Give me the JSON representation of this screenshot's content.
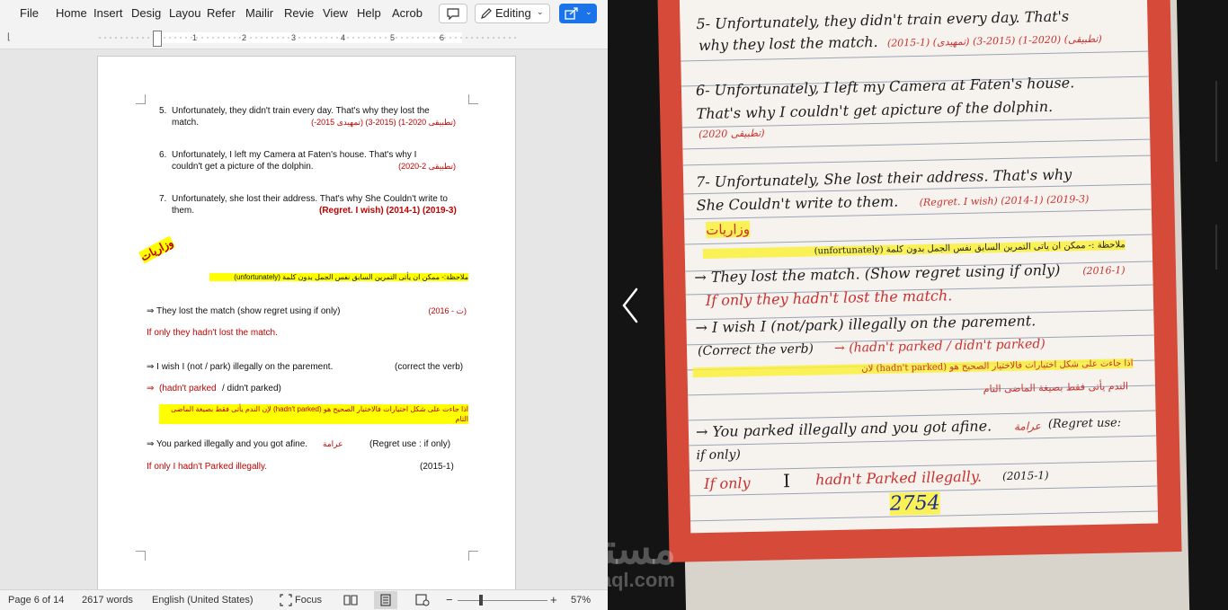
{
  "ribbon": {
    "tabs": [
      "File",
      "Home",
      "Insert",
      "Desig",
      "Layou",
      "Refer",
      "Mailir",
      "Revie",
      "View",
      "Help",
      "Acrob"
    ],
    "editing_label": "Editing"
  },
  "ruler": {
    "numbers": [
      "1",
      "2",
      "3",
      "4",
      "5",
      "6"
    ]
  },
  "document": {
    "item5": {
      "num": "5.",
      "line1": "Unfortunately, they didn't train every day. That's why they lost the",
      "line2": "match.",
      "ref": "(تطبيقى 2020-1) (2015-3) (تمهيدى 2015-)"
    },
    "item6": {
      "num": "6.",
      "line1": "Unfortunately, I left my Camera at Faten's house. That's why I",
      "line2": "couldn't get a picture of the dolphin.",
      "ref": "(تطبيقى 2-2020)"
    },
    "item7": {
      "num": "7.",
      "line1": "Unfortunately, she lost their address. That's why She Couldn't write to",
      "line2": "them.",
      "ref": "(Regret. I wish) (2014-1) (2019-3)"
    },
    "heading": "وزاريات",
    "note": "ملاحظة:- ممكن ان يأتى التمرين السابق نفس الجمل  بدون كلمة (unfortunately)",
    "q1": {
      "text": "⇒ They lost the match   (show regret using if only)",
      "ref": "(ت - 2016)",
      "answer": "If only they hadn't lost the match."
    },
    "q2": {
      "text": "⇒ I wish I  (not / park)  illegally on the parement.",
      "hint": "(correct the verb)",
      "answer_arrow": "⇒",
      "answer_red": "(hadn't parked",
      "answer_rest": " / didn't parked)",
      "note": "اذا جاءت على شكل اختيارات فالاختيار الصحيح هو (hadn't parked) لإن الندم يأتى فقط بصيغة الماضى التام"
    },
    "q3": {
      "text": "⇒  You parked illegally and you got afine.",
      "word": "عرامة",
      "hint": "(Regret use : if only)",
      "answer": "If only I hadn't Parked illegally.",
      "ref": "(2015-1)"
    }
  },
  "status": {
    "page": "Page 6 of 14",
    "words": "2617 words",
    "language": "English (United States)",
    "focus": "Focus",
    "zoom_minus": "−",
    "zoom_plus": "+",
    "zoom": "57%"
  },
  "notebook": {
    "l5a": "5- Unfortunately, they didn't train every day. That's",
    "l5b": "why they lost the match.",
    "l5ref": "(2015-1) (تمهيدى) (2015-3) (2020-1) (تطبيقى)",
    "l6a": "6- Unfortunately, I left my Camera at Faten's house.",
    "l6b": "That's why I couldn't get apicture of the dolphin.",
    "l6ref": "(2020 تطبيقى)",
    "l7a": "7- Unfortunately, She lost their address. That's why",
    "l7b": "She Couldn't write to them.",
    "l7ref": "(Regret. I wish) (2014-1) (2019-3)",
    "heading": "وزاريات",
    "note": "ملاحظة :- ممكن ان يأتى التمرين السابق نفس الجمل بدون كلمة (unfortunately)",
    "q1": "→ They lost the match. (Show regret using if only)",
    "q1ref": "(2016-1)",
    "q1ans": "If only they hadn't lost the match.",
    "q2": "→ I wish I (not/park) illegally on the parement.",
    "q2b": "(Correct the verb)",
    "q2ans": "→ (hadn't parked / didn't parked)",
    "q2note1": "اذا جاءت على شكل اختيارات فالاختيار الصحيح هو (hadn't parked) لان",
    "q2note2": "الندم يأتى فقط بصيغة الماضى التام",
    "q3": "→ You parked illegally and you got afine.",
    "q3word": "عرامة",
    "q3hint": "(Regret use:",
    "q3b": "if only)",
    "q3ans_a": "If only",
    "q3ans_b": "I",
    "q3ans_c": "hadn't Parked illegally.",
    "q3ref": "(2015-1)",
    "mark": "2754"
  },
  "watermark": {
    "line1": "مستقل",
    "line2": "mostaql.com"
  },
  "colors": {
    "accent_blue": "#1a73e8",
    "doc_red": "#c00000",
    "highlight": "#ffff00",
    "paper_red": "#d64a3a"
  }
}
